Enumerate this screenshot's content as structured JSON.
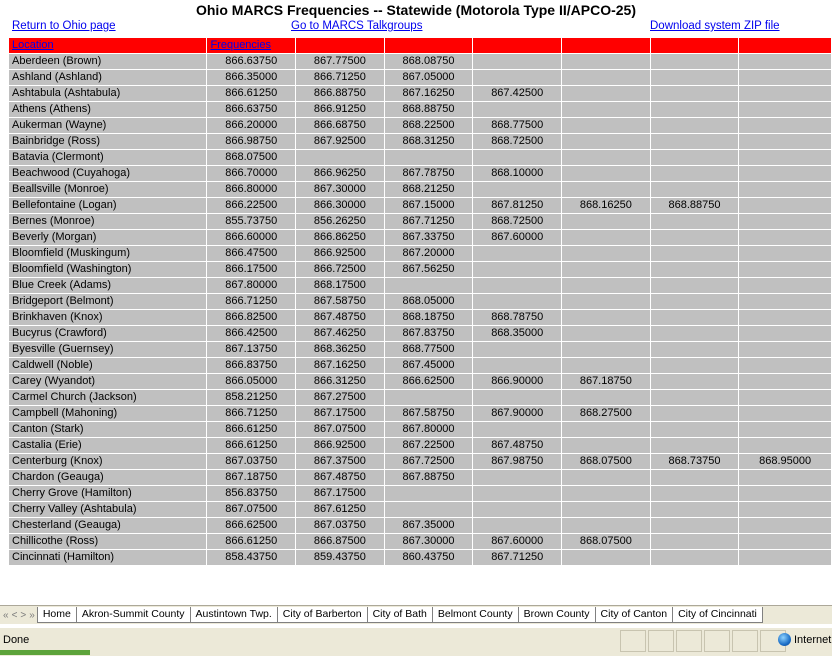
{
  "title": "Ohio MARCS Frequencies -- Statewide (Motorola Type II/APCO-25)",
  "links": {
    "return": "Return to Ohio page",
    "talkgroups": "Go to MARCS Talkgroups",
    "download": "Download system ZIP file"
  },
  "table": {
    "headers": {
      "location": "Location",
      "frequencies": "Frequencies"
    },
    "rows": [
      {
        "loc": "Aberdeen (Brown)",
        "f": [
          "866.63750",
          "867.77500",
          "868.08750",
          "",
          "",
          "",
          ""
        ]
      },
      {
        "loc": "Ashland (Ashland)",
        "f": [
          "866.35000",
          "866.71250",
          "867.05000",
          "",
          "",
          "",
          ""
        ]
      },
      {
        "loc": "Ashtabula (Ashtabula)",
        "f": [
          "866.61250",
          "866.88750",
          "867.16250",
          "867.42500",
          "",
          "",
          ""
        ]
      },
      {
        "loc": "Athens (Athens)",
        "f": [
          "866.63750",
          "866.91250",
          "868.88750",
          "",
          "",
          "",
          ""
        ]
      },
      {
        "loc": "Aukerman (Wayne)",
        "f": [
          "866.20000",
          "866.68750",
          "868.22500",
          "868.77500",
          "",
          "",
          ""
        ]
      },
      {
        "loc": "Bainbridge (Ross)",
        "f": [
          "866.98750",
          "867.92500",
          "868.31250",
          "868.72500",
          "",
          "",
          ""
        ]
      },
      {
        "loc": "Batavia (Clermont)",
        "f": [
          "868.07500",
          "",
          "",
          "",
          "",
          "",
          ""
        ]
      },
      {
        "loc": "Beachwood (Cuyahoga)",
        "f": [
          "866.70000",
          "866.96250",
          "867.78750",
          "868.10000",
          "",
          "",
          ""
        ]
      },
      {
        "loc": "Beallsville (Monroe)",
        "f": [
          "866.80000",
          "867.30000",
          "868.21250",
          "",
          "",
          "",
          ""
        ]
      },
      {
        "loc": "Bellefontaine (Logan)",
        "f": [
          "866.22500",
          "866.30000",
          "867.15000",
          "867.81250",
          "868.16250",
          "868.88750",
          ""
        ]
      },
      {
        "loc": "Bernes (Monroe)",
        "f": [
          "855.73750",
          "856.26250",
          "867.71250",
          "868.72500",
          "",
          "",
          ""
        ]
      },
      {
        "loc": "Beverly (Morgan)",
        "f": [
          "866.60000",
          "866.86250",
          "867.33750",
          "867.60000",
          "",
          "",
          ""
        ]
      },
      {
        "loc": "Bloomfield (Muskingum)",
        "f": [
          "866.47500",
          "866.92500",
          "867.20000",
          "",
          "",
          "",
          ""
        ]
      },
      {
        "loc": "Bloomfield (Washington)",
        "f": [
          "866.17500",
          "866.72500",
          "867.56250",
          "",
          "",
          "",
          ""
        ]
      },
      {
        "loc": "Blue Creek (Adams)",
        "f": [
          "867.80000",
          "868.17500",
          "",
          "",
          "",
          "",
          ""
        ]
      },
      {
        "loc": "Bridgeport (Belmont)",
        "f": [
          "866.71250",
          "867.58750",
          "868.05000",
          "",
          "",
          "",
          ""
        ]
      },
      {
        "loc": "Brinkhaven (Knox)",
        "f": [
          "866.82500",
          "867.48750",
          "868.18750",
          "868.78750",
          "",
          "",
          ""
        ]
      },
      {
        "loc": "Bucyrus (Crawford)",
        "f": [
          "866.42500",
          "867.46250",
          "867.83750",
          "868.35000",
          "",
          "",
          ""
        ]
      },
      {
        "loc": "Byesville (Guernsey)",
        "f": [
          "867.13750",
          "868.36250",
          "868.77500",
          "",
          "",
          "",
          ""
        ]
      },
      {
        "loc": "Caldwell (Noble)",
        "f": [
          "866.83750",
          "867.16250",
          "867.45000",
          "",
          "",
          "",
          ""
        ]
      },
      {
        "loc": "Carey (Wyandot)",
        "f": [
          "866.05000",
          "866.31250",
          "866.62500",
          "866.90000",
          "867.18750",
          "",
          ""
        ]
      },
      {
        "loc": "Carmel Church (Jackson)",
        "f": [
          "858.21250",
          "867.27500",
          "",
          "",
          "",
          "",
          ""
        ]
      },
      {
        "loc": "Campbell (Mahoning)",
        "f": [
          "866.71250",
          "867.17500",
          "867.58750",
          "867.90000",
          "868.27500",
          "",
          ""
        ]
      },
      {
        "loc": "Canton (Stark)",
        "f": [
          "866.61250",
          "867.07500",
          "867.80000",
          "",
          "",
          "",
          ""
        ]
      },
      {
        "loc": "Castalia (Erie)",
        "f": [
          "866.61250",
          "866.92500",
          "867.22500",
          "867.48750",
          "",
          "",
          ""
        ]
      },
      {
        "loc": "Centerburg (Knox)",
        "f": [
          "867.03750",
          "867.37500",
          "867.72500",
          "867.98750",
          "868.07500",
          "868.73750",
          "868.95000"
        ]
      },
      {
        "loc": "Chardon (Geauga)",
        "f": [
          "867.18750",
          "867.48750",
          "867.88750",
          "",
          "",
          "",
          ""
        ]
      },
      {
        "loc": "Cherry Grove (Hamilton)",
        "f": [
          "856.83750",
          "867.17500",
          "",
          "",
          "",
          "",
          ""
        ]
      },
      {
        "loc": "Cherry Valley (Ashtabula)",
        "f": [
          "867.07500",
          "867.61250",
          "",
          "",
          "",
          "",
          ""
        ]
      },
      {
        "loc": "Chesterland (Geauga)",
        "f": [
          "866.62500",
          "867.03750",
          "867.35000",
          "",
          "",
          "",
          ""
        ]
      },
      {
        "loc": "Chillicothe (Ross)",
        "f": [
          "866.61250",
          "866.87500",
          "867.30000",
          "867.60000",
          "868.07500",
          "",
          ""
        ]
      },
      {
        "loc": "Cincinnati (Hamilton)",
        "f": [
          "858.43750",
          "859.43750",
          "860.43750",
          "867.71250",
          "",
          "",
          ""
        ]
      }
    ]
  },
  "sheet_tabs": {
    "nav": [
      "«",
      "<",
      ">",
      "»"
    ],
    "tabs": [
      "Home",
      "Akron-Summit County",
      "Austintown Twp.",
      "City of Barberton",
      "City of Bath",
      "Belmont County",
      "Brown County",
      "City of Canton",
      "City of Cincinnati"
    ]
  },
  "status": {
    "text": "Done",
    "zone": "Internet"
  }
}
